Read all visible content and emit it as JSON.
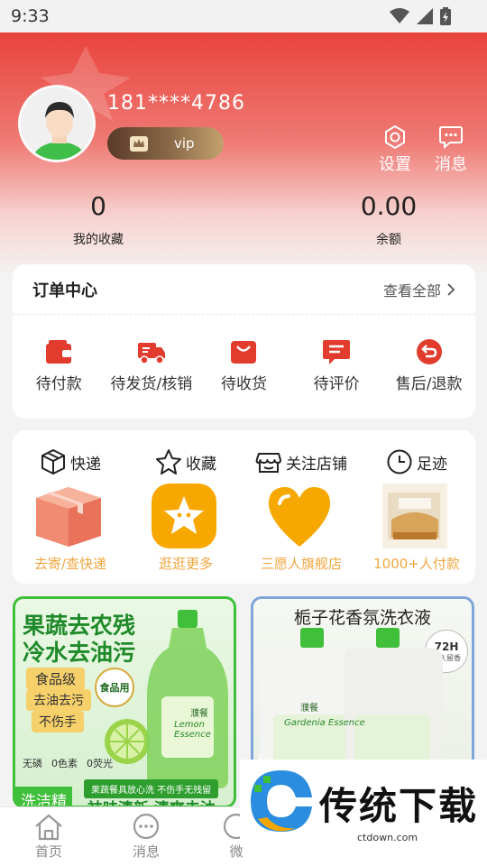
{
  "status_bar": {
    "time": "9:33"
  },
  "profile": {
    "phone": "181****4786",
    "vip_label": "vip"
  },
  "header_actions": {
    "settings": "设置",
    "messages": "消息"
  },
  "stats": [
    {
      "value": "0",
      "label": "我的收藏"
    },
    {
      "value": "0.00",
      "label": "余额"
    }
  ],
  "orders": {
    "title": "订单中心",
    "view_all": "查看全部",
    "items": [
      {
        "label": "待付款",
        "icon": "wallet-icon"
      },
      {
        "label": "待发货/核销",
        "icon": "truck-icon"
      },
      {
        "label": "待收货",
        "icon": "bag-icon"
      },
      {
        "label": "待评价",
        "icon": "comment-icon"
      },
      {
        "label": "售后/退款",
        "icon": "return-icon"
      }
    ]
  },
  "features": [
    {
      "title": "快递",
      "subtitle": "去寄/查快递",
      "icon": "box-icon"
    },
    {
      "title": "收藏",
      "subtitle": "逛逛更多",
      "icon": "star-icon"
    },
    {
      "title": "关注店铺",
      "subtitle": "三愿人旗舰店",
      "icon": "store-icon"
    },
    {
      "title": "足迹",
      "subtitle": "1000+人付款",
      "icon": "clock-icon"
    }
  ],
  "products": [
    {
      "headline_1": "果蔬去农残",
      "headline_2": "冷水去油污",
      "tags": [
        "食品级",
        "去油去污",
        "不伤手"
      ],
      "badge": "食品用",
      "bottom_tag": "洗洁精",
      "bottom_strip": "果蔬餐具放心洗 不伤手无残留",
      "bottom_slogan": "祛味清新 清爽去油",
      "bottle_brand": "濮餐",
      "bottle_name": "Lemon Essence",
      "icons_caption": [
        "无磷",
        "0色素",
        "0荧光"
      ]
    },
    {
      "headline": "栀子花香氛洗衣液",
      "badge_top": "72H",
      "badge_bottom": "持久留香",
      "bottle_brand": "濮餐",
      "bottle_name": "Gardenia Essence"
    }
  ],
  "tabbar": [
    "首页",
    "消息",
    "微"
  ],
  "watermark": {
    "text": "传统下载",
    "url": "ctdown.com"
  },
  "colors": {
    "brand_red": "#e9433c",
    "order_icon": "#e23c2f",
    "feature_orange": "#f0a640"
  }
}
